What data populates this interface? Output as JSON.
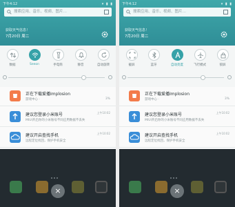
{
  "colors": {
    "accent": "#36a2a8",
    "header": "#3fa8aa",
    "notif_orange": "#f37b4b",
    "notif_blue": "#3a8ed8"
  },
  "phones": [
    {
      "status": {
        "time": "下午4:12",
        "icons": "▾ ▮ ▮"
      },
      "search_placeholder": "搜索应用、音乐、视频、图片…",
      "weather_line1": "获取天气信息！",
      "weather_line2": "7月20日 周二",
      "tiles": [
        {
          "label": "数据",
          "icon": "data-icon",
          "active": false
        },
        {
          "label": "Seeon",
          "icon": "wifi-icon",
          "active": true
        },
        {
          "label": "手电筒",
          "icon": "flashlight-icon",
          "active": false
        },
        {
          "label": "静音",
          "icon": "bell-icon",
          "active": false
        },
        {
          "label": "自动旋转",
          "icon": "rotate-icon",
          "active": false
        }
      ],
      "notifications": [
        {
          "title": "正在下载爱播Implosion",
          "sub": "游戏中心 ·",
          "time": "",
          "extra": "3%",
          "icon": "download-icon",
          "color": "#f37b4b"
        },
        {
          "title": "建议您登录小米账号",
          "sub": "MIUI开启你的小米账号不同应用数据不丢失",
          "time": "上午10:02",
          "extra": "",
          "icon": "upload-icon",
          "color": "#3a8ed8"
        },
        {
          "title": "建议开启查找手机",
          "sub": "远程定位找回，保护手机安全",
          "time": "上午10:02",
          "extra": "",
          "icon": "cloud-icon",
          "color": "#3a8ed8"
        }
      ]
    },
    {
      "status": {
        "time": "下午4:12",
        "icons": "▾ ▮ ▮"
      },
      "search_placeholder": "搜索应用、音乐、视频、图片…",
      "weather_line1": "获取天气信息！",
      "weather_line2": "7月20日 周二",
      "tiles": [
        {
          "label": "截屏",
          "icon": "screenshot-icon",
          "active": false
        },
        {
          "label": "蓝牙",
          "icon": "bluetooth-icon",
          "active": false
        },
        {
          "label": "自动亮度",
          "icon": "auto-brightness-icon",
          "active": true
        },
        {
          "label": "飞行模式",
          "icon": "airplane-icon",
          "active": false
        },
        {
          "label": "锁屏",
          "icon": "lock-icon",
          "active": false
        }
      ],
      "notifications": [
        {
          "title": "正在下载爱播Implosion",
          "sub": "游戏中心 ·",
          "time": "",
          "extra": "3%",
          "icon": "download-icon",
          "color": "#f37b4b"
        },
        {
          "title": "建议您登录小米账号",
          "sub": "MIUI开启你的小米账号不同应用数据不丢失",
          "time": "上午10:02",
          "extra": "",
          "icon": "upload-icon",
          "color": "#3a8ed8"
        },
        {
          "title": "建议开启查找手机",
          "sub": "远程定位找回，保护手机安全",
          "time": "上午10:02",
          "extra": "",
          "icon": "cloud-icon",
          "color": "#3a8ed8"
        }
      ]
    }
  ],
  "close_label": "×"
}
